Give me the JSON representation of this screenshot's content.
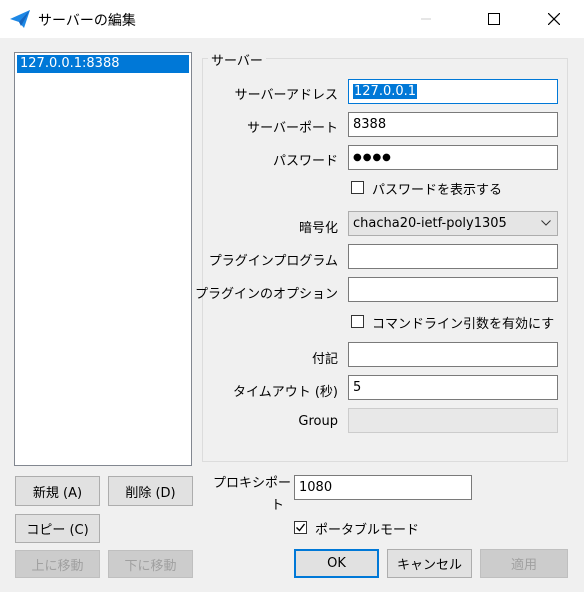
{
  "window": {
    "title": "サーバーの編集",
    "icon": "paper-plane-icon",
    "min_icon": "minimize-icon",
    "max_icon": "maximize-icon",
    "close_icon": "close-icon"
  },
  "server_list": {
    "items": [
      {
        "label": "127.0.0.1:8388",
        "selected": true
      }
    ]
  },
  "left_buttons": {
    "new": "新規 (A)",
    "delete": "削除 (D)",
    "copy": "コピー (C)",
    "move_up": "上に移動",
    "move_down": "下に移動"
  },
  "server_group": {
    "title": "サーバー",
    "address_label": "サーバーアドレス",
    "address_value": "127.0.0.1",
    "port_label": "サーバーポート",
    "port_value": "8388",
    "password_label": "パスワード",
    "password_value": "●●●●",
    "show_password_label": "パスワードを表示する",
    "show_password_checked": false,
    "encryption_label": "暗号化",
    "encryption_value": "chacha20-ietf-poly1305",
    "plugin_program_label": "プラグインプログラム",
    "plugin_program_value": "",
    "plugin_options_label": "プラグインのオプション",
    "plugin_options_value": "",
    "cmdline_args_label": "コマンドライン引数を有効にす",
    "cmdline_args_checked": false,
    "remarks_label": "付記",
    "remarks_value": "",
    "timeout_label": "タイムアウト (秒)",
    "timeout_value": "5",
    "group_label": "Group",
    "group_value": ""
  },
  "proxy": {
    "port_label_line1": "プロキシポー",
    "port_label_line2": "ト",
    "port_value": "1080",
    "portable_mode_label": "ポータブルモード",
    "portable_mode_checked": true
  },
  "dialog_buttons": {
    "ok": "OK",
    "cancel": "キャンセル",
    "apply": "適用"
  },
  "colors": {
    "accent": "#0078d7",
    "window_bg": "#f0f0f0"
  }
}
